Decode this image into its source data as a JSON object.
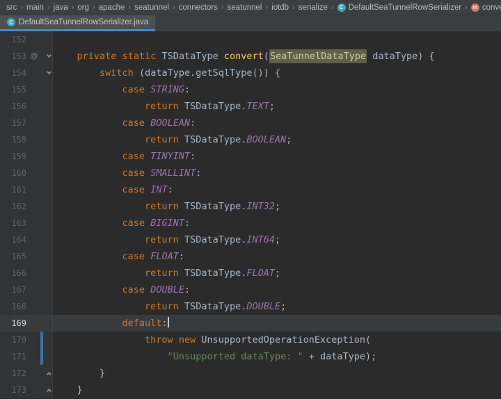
{
  "navbar": {
    "separator": "›",
    "path": [
      "src",
      "main",
      "java",
      "org",
      "apache",
      "seatunnel",
      "connectors",
      "seatunnel",
      "iotdb",
      "serialize"
    ],
    "class_item": {
      "label": "DefaultSeaTunnelRowSerializer",
      "icon_letter": "C"
    },
    "method_item": {
      "label": "convert",
      "icon_letter": "m"
    }
  },
  "tab_bar": {
    "active_tab": {
      "label": "DefaultSeaTunnelRowSerializer.java",
      "icon_letter": "C"
    }
  },
  "colors": {
    "keyword": "#CC7832",
    "plain_text": "#A9B7C6",
    "method_name": "#FFC66B",
    "constant": "#9876AA",
    "string": "#6A8759",
    "identifier_highlight_bg": "#5F6147",
    "active_tab_underline": "#4A88C7",
    "vcs_change_marker": "#3E6E9E",
    "editor_bg": "#2B2B2B",
    "gutter_bg": "#313335",
    "bar_bg": "#3C3F41"
  },
  "editor": {
    "lines": [
      {
        "num": "152",
        "tokens": []
      },
      {
        "num": "153",
        "annotation": "@",
        "fold": "down",
        "tokens": [
          [
            "plain",
            "    "
          ],
          [
            "kw",
            "private"
          ],
          [
            "plain",
            " "
          ],
          [
            "kw",
            "static"
          ],
          [
            "plain",
            " TSDataType "
          ],
          [
            "fn",
            "convert"
          ],
          [
            "plain",
            "("
          ],
          [
            "hl",
            "SeaTunnelDataType"
          ],
          [
            "plain",
            " dataType) {"
          ]
        ]
      },
      {
        "num": "154",
        "fold": "down",
        "tokens": [
          [
            "plain",
            "        "
          ],
          [
            "kw",
            "switch"
          ],
          [
            "plain",
            " (dataType.getSqlType()) {"
          ]
        ]
      },
      {
        "num": "155",
        "tokens": [
          [
            "plain",
            "            "
          ],
          [
            "kw",
            "case"
          ],
          [
            "plain",
            " "
          ],
          [
            "const",
            "STRING"
          ],
          [
            "plain",
            ":"
          ]
        ]
      },
      {
        "num": "156",
        "tokens": [
          [
            "plain",
            "                "
          ],
          [
            "kw",
            "return"
          ],
          [
            "plain",
            " TSDataType."
          ],
          [
            "const",
            "TEXT"
          ],
          [
            "plain",
            ";"
          ]
        ]
      },
      {
        "num": "157",
        "tokens": [
          [
            "plain",
            "            "
          ],
          [
            "kw",
            "case"
          ],
          [
            "plain",
            " "
          ],
          [
            "const",
            "BOOLEAN"
          ],
          [
            "plain",
            ":"
          ]
        ]
      },
      {
        "num": "158",
        "tokens": [
          [
            "plain",
            "                "
          ],
          [
            "kw",
            "return"
          ],
          [
            "plain",
            " TSDataType."
          ],
          [
            "const",
            "BOOLEAN"
          ],
          [
            "plain",
            ";"
          ]
        ]
      },
      {
        "num": "159",
        "tokens": [
          [
            "plain",
            "            "
          ],
          [
            "kw",
            "case"
          ],
          [
            "plain",
            " "
          ],
          [
            "const",
            "TINYINT"
          ],
          [
            "plain",
            ":"
          ]
        ]
      },
      {
        "num": "160",
        "tokens": [
          [
            "plain",
            "            "
          ],
          [
            "kw",
            "case"
          ],
          [
            "plain",
            " "
          ],
          [
            "const",
            "SMALLINT"
          ],
          [
            "plain",
            ":"
          ]
        ]
      },
      {
        "num": "161",
        "tokens": [
          [
            "plain",
            "            "
          ],
          [
            "kw",
            "case"
          ],
          [
            "plain",
            " "
          ],
          [
            "const",
            "INT"
          ],
          [
            "plain",
            ":"
          ]
        ]
      },
      {
        "num": "162",
        "tokens": [
          [
            "plain",
            "                "
          ],
          [
            "kw",
            "return"
          ],
          [
            "plain",
            " TSDataType."
          ],
          [
            "const",
            "INT32"
          ],
          [
            "plain",
            ";"
          ]
        ]
      },
      {
        "num": "163",
        "tokens": [
          [
            "plain",
            "            "
          ],
          [
            "kw",
            "case"
          ],
          [
            "plain",
            " "
          ],
          [
            "const",
            "BIGINT"
          ],
          [
            "plain",
            ":"
          ]
        ]
      },
      {
        "num": "164",
        "tokens": [
          [
            "plain",
            "                "
          ],
          [
            "kw",
            "return"
          ],
          [
            "plain",
            " TSDataType."
          ],
          [
            "const",
            "INT64"
          ],
          [
            "plain",
            ";"
          ]
        ]
      },
      {
        "num": "165",
        "tokens": [
          [
            "plain",
            "            "
          ],
          [
            "kw",
            "case"
          ],
          [
            "plain",
            " "
          ],
          [
            "const",
            "FLOAT"
          ],
          [
            "plain",
            ":"
          ]
        ]
      },
      {
        "num": "166",
        "tokens": [
          [
            "plain",
            "                "
          ],
          [
            "kw",
            "return"
          ],
          [
            "plain",
            " TSDataType."
          ],
          [
            "const",
            "FLOAT"
          ],
          [
            "plain",
            ";"
          ]
        ]
      },
      {
        "num": "167",
        "tokens": [
          [
            "plain",
            "            "
          ],
          [
            "kw",
            "case"
          ],
          [
            "plain",
            " "
          ],
          [
            "const",
            "DOUBLE"
          ],
          [
            "plain",
            ":"
          ]
        ]
      },
      {
        "num": "168",
        "tokens": [
          [
            "plain",
            "                "
          ],
          [
            "kw",
            "return"
          ],
          [
            "plain",
            " TSDataType."
          ],
          [
            "const",
            "DOUBLE"
          ],
          [
            "plain",
            ";"
          ]
        ]
      },
      {
        "num": "169",
        "current": true,
        "caret": true,
        "tokens": [
          [
            "plain",
            "            "
          ],
          [
            "kw",
            "default"
          ],
          [
            "plain",
            ":"
          ]
        ]
      },
      {
        "num": "170",
        "changed": true,
        "tokens": [
          [
            "plain",
            "                "
          ],
          [
            "kw",
            "throw"
          ],
          [
            "plain",
            " "
          ],
          [
            "kw",
            "new"
          ],
          [
            "plain",
            " UnsupportedOperationException("
          ]
        ]
      },
      {
        "num": "171",
        "changed": true,
        "tokens": [
          [
            "plain",
            "                    "
          ],
          [
            "str",
            "\"Unsupported dataType: \""
          ],
          [
            "plain",
            " + dataType);"
          ]
        ]
      },
      {
        "num": "172",
        "fold": "up",
        "tokens": [
          [
            "plain",
            "        }"
          ]
        ]
      },
      {
        "num": "173",
        "fold": "up",
        "tokens": [
          [
            "plain",
            "    }"
          ]
        ]
      }
    ]
  }
}
